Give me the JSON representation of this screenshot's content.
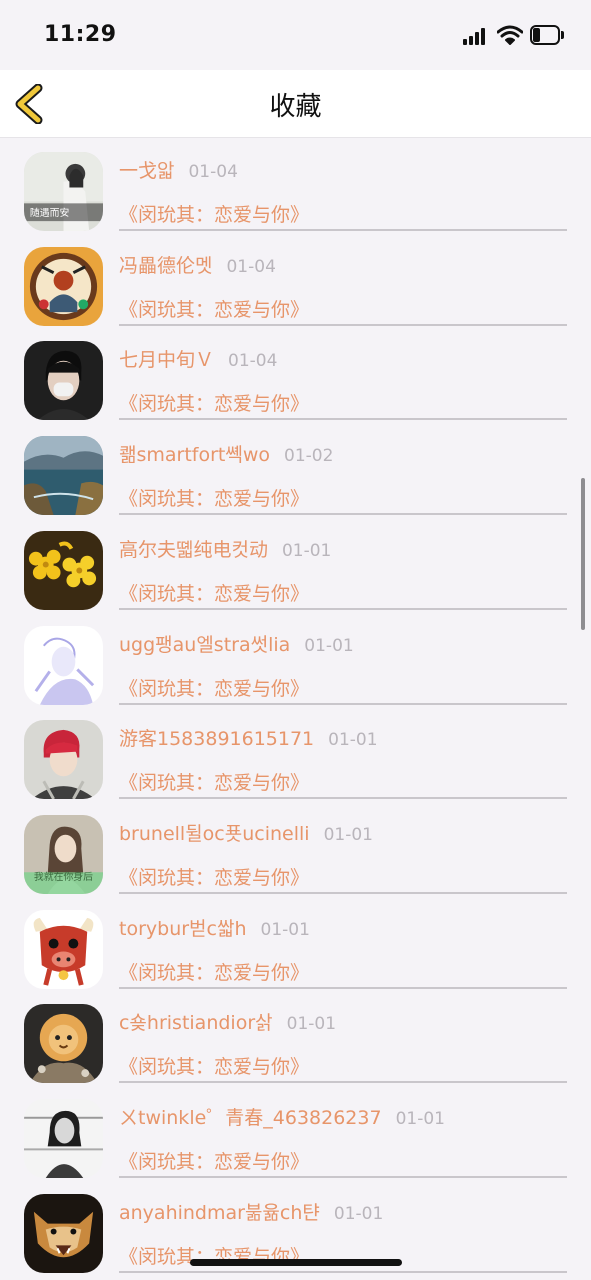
{
  "status_bar": {
    "time": "11:29",
    "battery_level_fraction": 0.3
  },
  "nav": {
    "title": "收藏",
    "accent_color": "#f0c83a"
  },
  "colors": {
    "username_text": "#e7956a",
    "date_text": "#b9b5bb",
    "divider": "#c9c6cb",
    "background": "#f5f3f7"
  },
  "favorites": [
    {
      "username": "一戈앏",
      "date": "01-04",
      "title": "《闵玧其：恋爱与你》",
      "avatar_icon": "avatar-girl-with-text",
      "avatar_text": "随遇而安"
    },
    {
      "username": "冯畾德伦멧",
      "date": "01-04",
      "title": "《闵玧其：恋爱与你》",
      "avatar_icon": "avatar-artwork"
    },
    {
      "username": "七月中旬Ｖ",
      "date": "01-04",
      "title": "《闵玧其：恋爱与你》",
      "avatar_icon": "avatar-masked-person"
    },
    {
      "username": "쾖smartfort쎽wo",
      "date": "01-02",
      "title": "《闵玧其：恋爱与你》",
      "avatar_icon": "avatar-seascape"
    },
    {
      "username": "高尔夫뗿纯电컷动",
      "date": "01-01",
      "title": "《闵玧其：恋爱与你》",
      "avatar_icon": "avatar-yellow-flowers"
    },
    {
      "username": "ugg팽au엘stra썻lia",
      "date": "01-01",
      "title": "《闵玧其：恋爱与你》",
      "avatar_icon": "avatar-sketch"
    },
    {
      "username": "游客1583891615171",
      "date": "01-01",
      "title": "《闵玧其：恋爱与你》",
      "avatar_icon": "avatar-red-hair-person"
    },
    {
      "username": "brunell뒬oc푯ucinelli",
      "date": "01-01",
      "title": "《闵玧其：恋爱与你》",
      "avatar_icon": "avatar-girl-green",
      "avatar_text": "我就在你身后"
    },
    {
      "username": "torybur벋c쌃h",
      "date": "01-01",
      "title": "《闵玧其：恋爱与你》",
      "avatar_icon": "avatar-cartoon-bull"
    },
    {
      "username": "c숒hristiandior삵",
      "date": "01-01",
      "title": "《闵玧其：恋爱与你》",
      "avatar_icon": "avatar-lion-cat"
    },
    {
      "username": "ㄨtwinkle゜青春_463826237",
      "date": "01-01",
      "title": "《闵玧其：恋爱与你》",
      "avatar_icon": "avatar-bw-girl"
    },
    {
      "username": "anyahindmar붊윪ch탼",
      "date": "01-01",
      "title": "《闵玧其：恋爱与你》",
      "avatar_icon": "avatar-wolf"
    }
  ]
}
